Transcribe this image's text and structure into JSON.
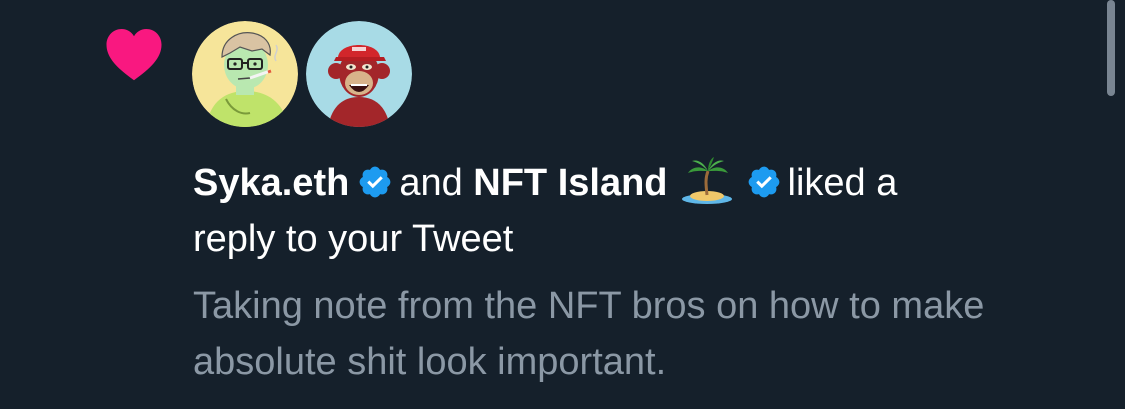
{
  "notification": {
    "user1": "Syka.eth",
    "connector": "and",
    "user2": "NFT Island",
    "action_line1": "liked a",
    "action_line2": "reply to your Tweet",
    "tweet_text": "Taking note from the NFT bros on how to make absolute shit look important."
  },
  "icons": {
    "type_icon": "heart-icon",
    "verified_badge": "verified-badge-icon",
    "island_emoji": "desert-island-emoji"
  },
  "colors": {
    "background": "#15202b",
    "heart": "#f91880",
    "verified": "#1d9bf0",
    "primary_text": "#ffffff",
    "secondary_text": "#8b98a5"
  }
}
